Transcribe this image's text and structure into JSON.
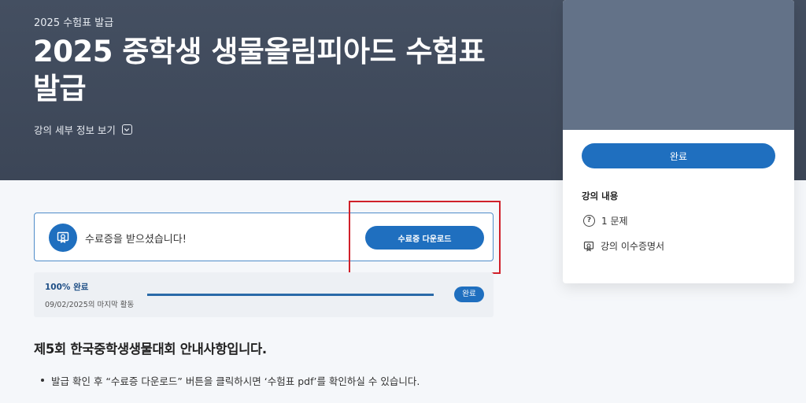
{
  "hero": {
    "overline": "2025 수험표 발급",
    "title": "2025 중학생 생물올림피아드 수험표 발급",
    "details_toggle": "강의 세부 정보 보기",
    "colors": {
      "background": "#424d5f",
      "text": "#ffffff"
    }
  },
  "sidebar": {
    "complete_button": "완료",
    "section_title": "강의 내용",
    "items": [
      {
        "icon": "question-circle-icon",
        "label": "1 문제"
      },
      {
        "icon": "certificate-icon",
        "label": "강의 이수증명서"
      }
    ]
  },
  "certificate": {
    "message": "수료증을 받으셨습니다!",
    "download_button": "수료증 다운로드",
    "icon": "certificate-icon"
  },
  "progress": {
    "label": "100% 완료",
    "value_percent": 100,
    "last_activity": "09/02/2025의 마지막 활동",
    "badge": "완료"
  },
  "notice": {
    "heading": "제5회 한국중학생생물대회 안내사항입니다.",
    "items": [
      "발급 확인 후 “수료증 다운로드” 버튼을 클릭하시면 ‘수험표 pdf’를 확인하실 수 있습니다."
    ]
  },
  "colors": {
    "accent": "#1f6fbf",
    "highlight": "#d0202a",
    "page_background": "#f5f7fa"
  }
}
